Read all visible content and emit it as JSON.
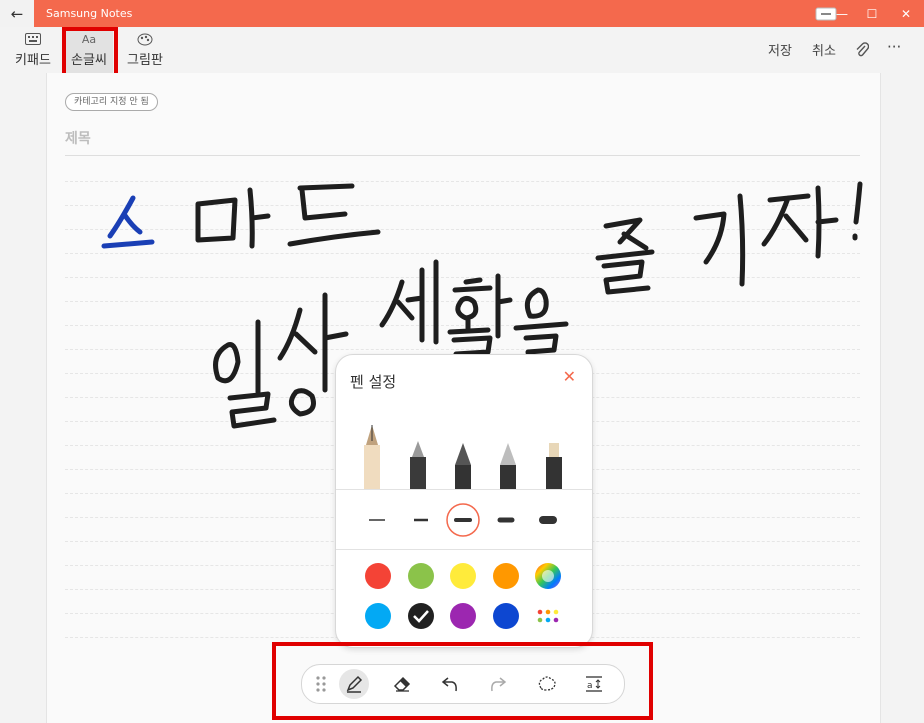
{
  "app": {
    "title": "Samsung Notes"
  },
  "toolbar": {
    "modes": [
      {
        "label": "키패드",
        "icon": "keyboard-icon"
      },
      {
        "label": "손글씨",
        "icon": "handwriting-icon",
        "icon_text": "Aa"
      },
      {
        "label": "그림판",
        "icon": "palette-icon"
      }
    ],
    "save": "저장",
    "cancel": "취소",
    "more": "···"
  },
  "note": {
    "category_chip": "카테고리 지정 안 됨",
    "title_placeholder": "제목"
  },
  "pen_panel": {
    "title": "펜 설정",
    "pens": [
      "fountain-pen-icon",
      "calligraphy-pen-icon",
      "pencil-icon",
      "marker-icon",
      "highlighter-icon"
    ],
    "selected_thickness_index": 2,
    "colors_row1": [
      "#f44336",
      "#8bc34a",
      "#ffeb3b",
      "#ff9800",
      "rainbow"
    ],
    "colors_row2": [
      "#03a9f4",
      "#212121",
      "#9c27b0",
      "#0d47d1",
      "more-colors"
    ],
    "selected_color": "#212121"
  },
  "bottom_toolbar": {
    "items": [
      "drag-handle-icon",
      "pen-icon",
      "eraser-icon",
      "undo-icon",
      "redo-icon",
      "lasso-icon",
      "text-spacing-icon"
    ]
  },
  "colors": {
    "brand": "#f4694d",
    "highlight": "#e00000"
  }
}
